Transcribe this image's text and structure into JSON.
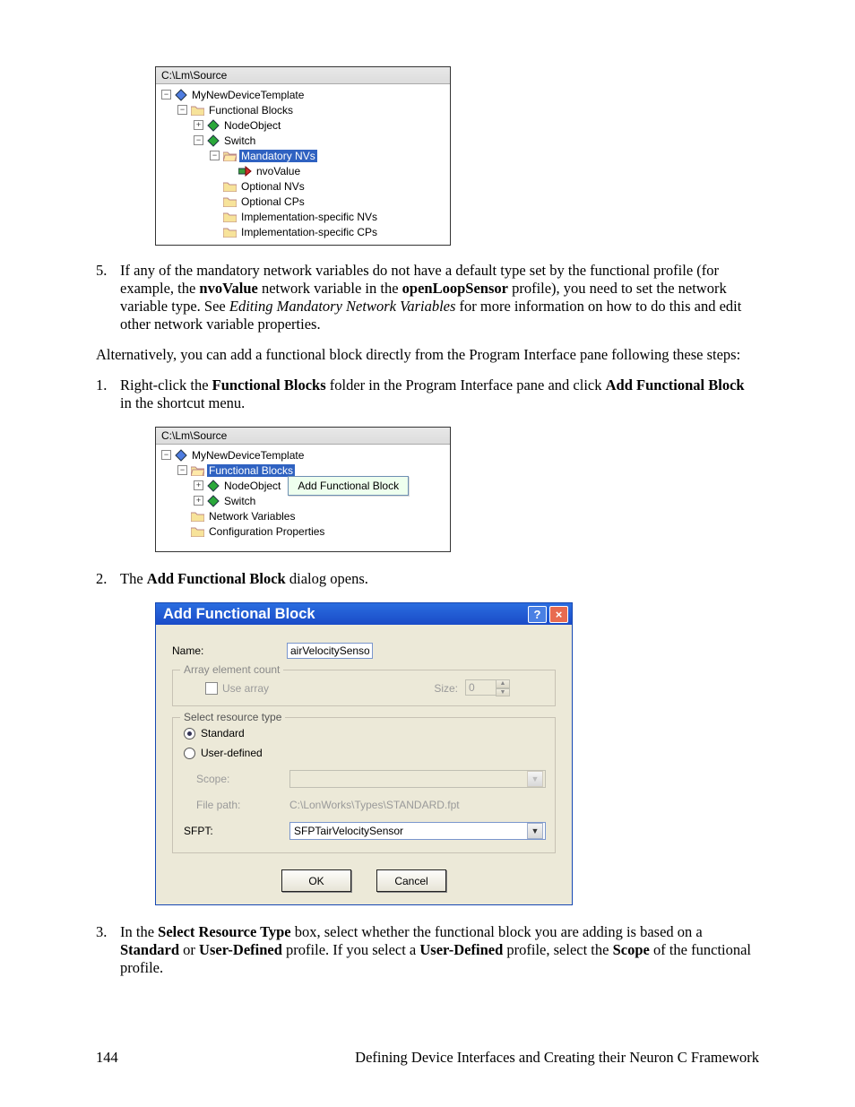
{
  "fig1": {
    "title": "C:\\Lm\\Source",
    "n1": "MyNewDeviceTemplate",
    "n2": "Functional Blocks",
    "n3": "NodeObject",
    "n4": "Switch",
    "n5": "Mandatory NVs",
    "n6": "nvoValue",
    "n7": "Optional NVs",
    "n8": "Optional CPs",
    "n9": "Implementation-specific NVs",
    "n10": "Implementation-specific CPs"
  },
  "step5": {
    "prefix": "If any of the mandatory network variables do not have a default type set by the functional profile (for example, the ",
    "b1": "nvoValue",
    "t2": " network variable in the ",
    "b2": "openLoopSensor",
    "t3": " profile), you need to set the network variable type.  See ",
    "i1": "Editing Mandatory Network Variables",
    "t4": " for more information on how to do this and edit other network variable properties."
  },
  "alt": "Alternatively, you can add a functional block directly from the Program Interface pane following these steps:",
  "step1b": {
    "t1": "Right-click the ",
    "b1": "Functional Blocks",
    "t2": " folder in the Program Interface pane and click ",
    "b2": "Add Functional Block",
    "t3": " in the shortcut menu."
  },
  "fig2": {
    "title": "C:\\Lm\\Source",
    "n1": "MyNewDeviceTemplate",
    "n2": "Functional Blocks",
    "n3": "NodeObject",
    "n4": "Switch",
    "n5": "Network Variables",
    "n6": "Configuration Properties",
    "menu": "Add Functional Block"
  },
  "step2b": {
    "t1": "The ",
    "b1": "Add Functional Block",
    "t2": " dialog opens."
  },
  "dlg": {
    "title": "Add Functional Block",
    "name_label": "Name:",
    "name_value": "airVelocitySenso",
    "arr_legend": "Array element count",
    "arr_check": "Use array",
    "size_label": "Size:",
    "size_value": "0",
    "res_legend": "Select resource type",
    "opt_std": "Standard",
    "opt_usr": "User-defined",
    "scope_label": "Scope:",
    "file_label": "File path:",
    "file_value": "C:\\LonWorks\\Types\\STANDARD.fpt",
    "sfpt_label": "SFPT:",
    "sfpt_value": "SFPTairVelocitySensor",
    "ok": "OK",
    "cancel": "Cancel"
  },
  "step3b": {
    "t1": "In the ",
    "b1": "Select Resource Type",
    "t2": " box, select whether the functional block you are adding is based on a ",
    "b2": "Standard",
    "t3": " or ",
    "b3": "User-Defined",
    "t4": " profile.  If you select a ",
    "b4": "User-Defined",
    "t5": " profile, select the ",
    "b5": "Scope",
    "t6": " of the functional profile."
  },
  "footer": {
    "page": "144",
    "chap": "Defining Device Interfaces and Creating their Neuron C Framework"
  }
}
